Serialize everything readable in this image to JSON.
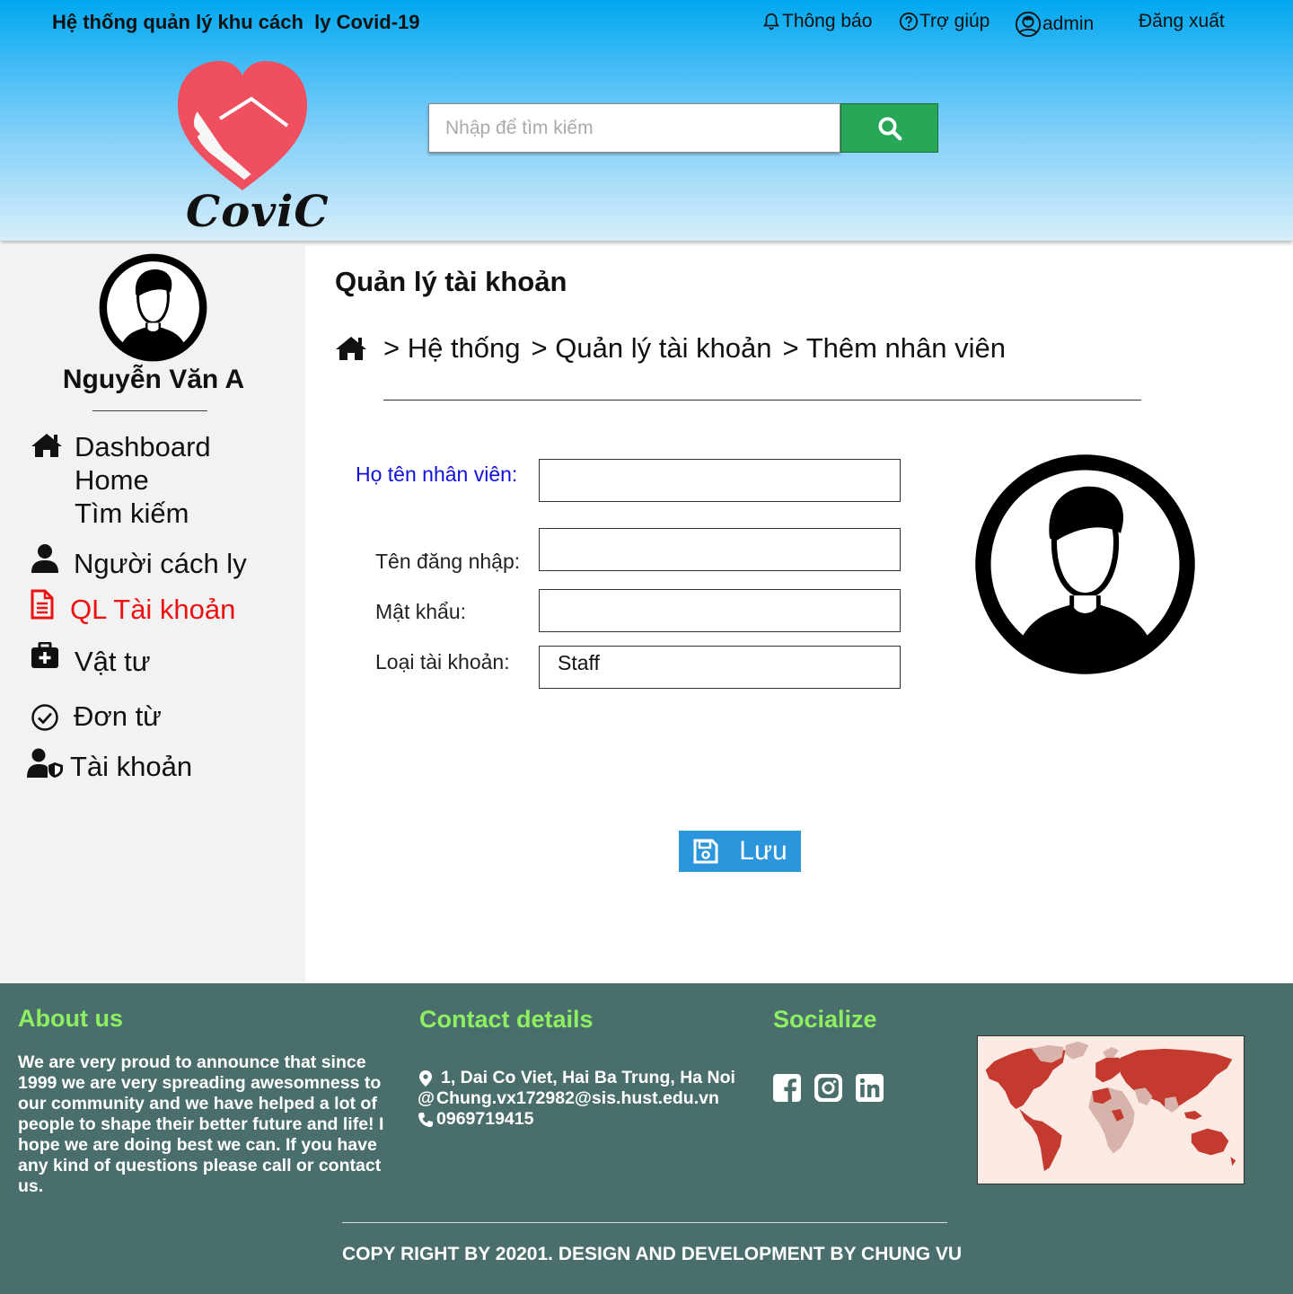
{
  "header": {
    "app_title": "Hệ thống quản lý khu cách  ly Covid-19",
    "logo_text": "CoviC",
    "nav": {
      "notifications": "Thông báo",
      "help": "Trợ giúp",
      "user": "admin",
      "logout": "Đăng xuất"
    },
    "search": {
      "placeholder": "Nhập để tìm kiếm"
    }
  },
  "sidebar": {
    "user_name": "Nguyễn Văn A",
    "items": {
      "dashboard": "Dashboard",
      "home": "Home",
      "search": "Tìm kiếm",
      "isolated_people": "Người cách ly",
      "account_mgmt": "QL Tài khoản",
      "supplies": "Vật tư",
      "forms": "Đơn từ",
      "account": "Tài khoản"
    },
    "active_item": "account_mgmt"
  },
  "main": {
    "title": "Quản lý tài khoản",
    "breadcrumb": [
      "> Hệ thống",
      "> Quản lý tài khoản",
      "> Thêm nhân viên"
    ],
    "form": {
      "full_name_label": "Họ tên nhân viên:",
      "username_label": "Tên đăng nhập:",
      "password_label": "Mật khẩu:",
      "account_type_label": "Loại tài khoản:",
      "full_name_value": "",
      "username_value": "",
      "password_value": "",
      "account_type_value": "Staff"
    },
    "save_label": "Lưu"
  },
  "footer": {
    "about_title": "About us",
    "about_text": "We are very proud to announce that since 1999 we are very spreading awesomness to our community and we have helped a lot of people to shape their better future and life! I hope we are doing best we can. If you have any kind of questions please call or contact us.",
    "contact_title": "Contact details",
    "address": "1, Dai Co Viet, Hai Ba Trung, Ha Noi",
    "email_prefix": "@",
    "email": "Chung.vx172982@sis.hust.edu.vn",
    "phone": "0969719415",
    "social_title": "Socialize",
    "social_icons": [
      "facebook-icon",
      "instagram-icon",
      "linkedin-icon"
    ],
    "copyright": "COPY RIGHT BY 20201. DESIGN AND DEVELOPMENT BY CHUNG VU"
  },
  "colors": {
    "accent_active": "#ee1111",
    "search_button": "#27a858",
    "save_button": "#2b96db",
    "footer_bg": "#4a6e6c",
    "footer_heading": "#8cf060",
    "required_label": "#1111dd"
  }
}
